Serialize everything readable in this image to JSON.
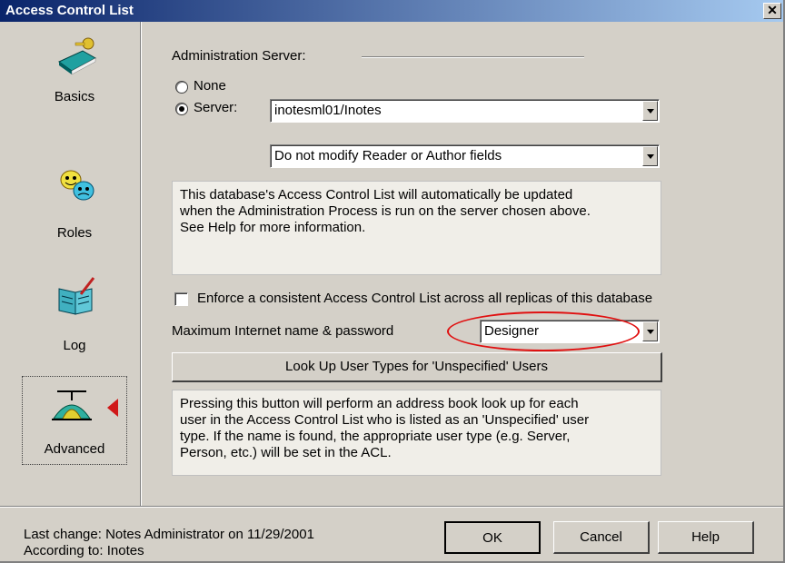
{
  "window": {
    "title": "Access Control List",
    "close_glyph": "✕"
  },
  "nav": {
    "items": [
      {
        "label": "Basics",
        "icon": "book-key-icon"
      },
      {
        "label": "Roles",
        "icon": "masks-icon"
      },
      {
        "label": "Log",
        "icon": "log-book-icon"
      },
      {
        "label": "Advanced",
        "icon": "propeller-hat-icon",
        "selected": true
      }
    ]
  },
  "admin": {
    "heading": "Administration Server:",
    "none_label": "None",
    "server_label": "Server:",
    "server_selected": true,
    "server_value": "inotesml01/Inotes",
    "modify_value": "Do not modify Reader or Author fields",
    "info": "This database's Access Control List will automatically be updated\nwhen the Administration Process is run on the server chosen above.\nSee Help for more information."
  },
  "enforce": {
    "label": "Enforce a consistent Access Control List across all replicas of this database",
    "checked": false
  },
  "max_internet": {
    "label": "Maximum Internet name & password",
    "value": "Designer"
  },
  "lookup": {
    "button_label": "Look Up User Types for 'Unspecified' Users",
    "info": "Pressing this button will perform an address book look up for each\nuser in the Access Control List who is listed as an 'Unspecified' user\ntype.  If the name is found, the appropriate user type (e.g. Server,\nPerson, etc.) will be set in the ACL."
  },
  "footer": {
    "last_change": "Last change: Notes Administrator on 11/29/2001",
    "according_to": "According to: Inotes",
    "ok": "OK",
    "cancel": "Cancel",
    "help": "Help"
  },
  "colors": {
    "accent": "#0a246a",
    "highlight": "#e01010",
    "face": "#d4d0c8"
  }
}
